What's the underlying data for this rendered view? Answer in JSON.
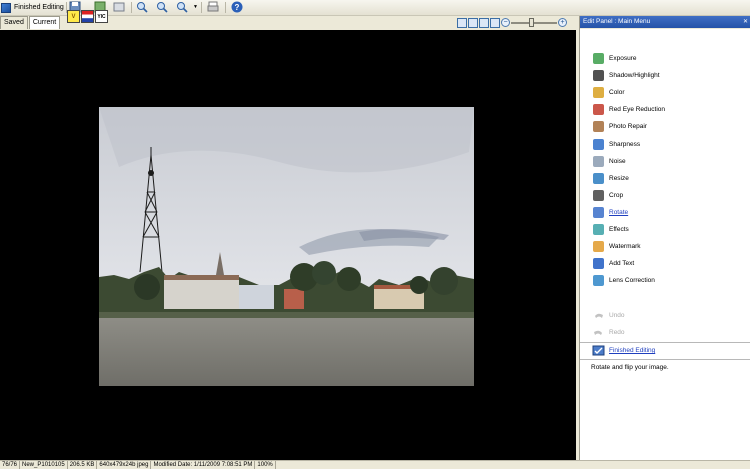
{
  "toolbar": {
    "finish_label": "Finished Editing",
    "tooltip_icons": [
      "V",
      "",
      "YIC"
    ]
  },
  "tabs": [
    {
      "label": "Saved"
    },
    {
      "label": "Current"
    }
  ],
  "zoom": {
    "slider_level": 0.45
  },
  "panel": {
    "title": "Edit Panel : Main Menu",
    "items": [
      {
        "label": "Exposure",
        "icon": "exposure-icon"
      },
      {
        "label": "Shadow/Highlight",
        "icon": "shadow-highlight-icon"
      },
      {
        "label": "Color",
        "icon": "color-icon"
      },
      {
        "label": "Red Eye Reduction",
        "icon": "red-eye-icon"
      },
      {
        "label": "Photo Repair",
        "icon": "photo-repair-icon"
      },
      {
        "label": "Sharpness",
        "icon": "sharpness-icon"
      },
      {
        "label": "Noise",
        "icon": "noise-icon"
      },
      {
        "label": "Resize",
        "icon": "resize-icon"
      },
      {
        "label": "Crop",
        "icon": "crop-icon"
      },
      {
        "label": "Rotate",
        "icon": "rotate-icon"
      },
      {
        "label": "Effects",
        "icon": "effects-icon"
      },
      {
        "label": "Watermark",
        "icon": "watermark-icon"
      },
      {
        "label": "Add Text",
        "icon": "add-text-icon"
      },
      {
        "label": "Lens Correction",
        "icon": "lens-correction-icon"
      }
    ],
    "undo_label": "Undo",
    "redo_label": "Redo",
    "finished_label": "Finished Editing",
    "hint": "Rotate and flip your image."
  },
  "status": {
    "index": "76/76",
    "name": "New_P1010105",
    "size": "206.5 KB",
    "dims": "640x479x24b jpeg",
    "modified": "Modified Date: 1/11/2009 7:08:51 PM",
    "zoom": "100%"
  }
}
